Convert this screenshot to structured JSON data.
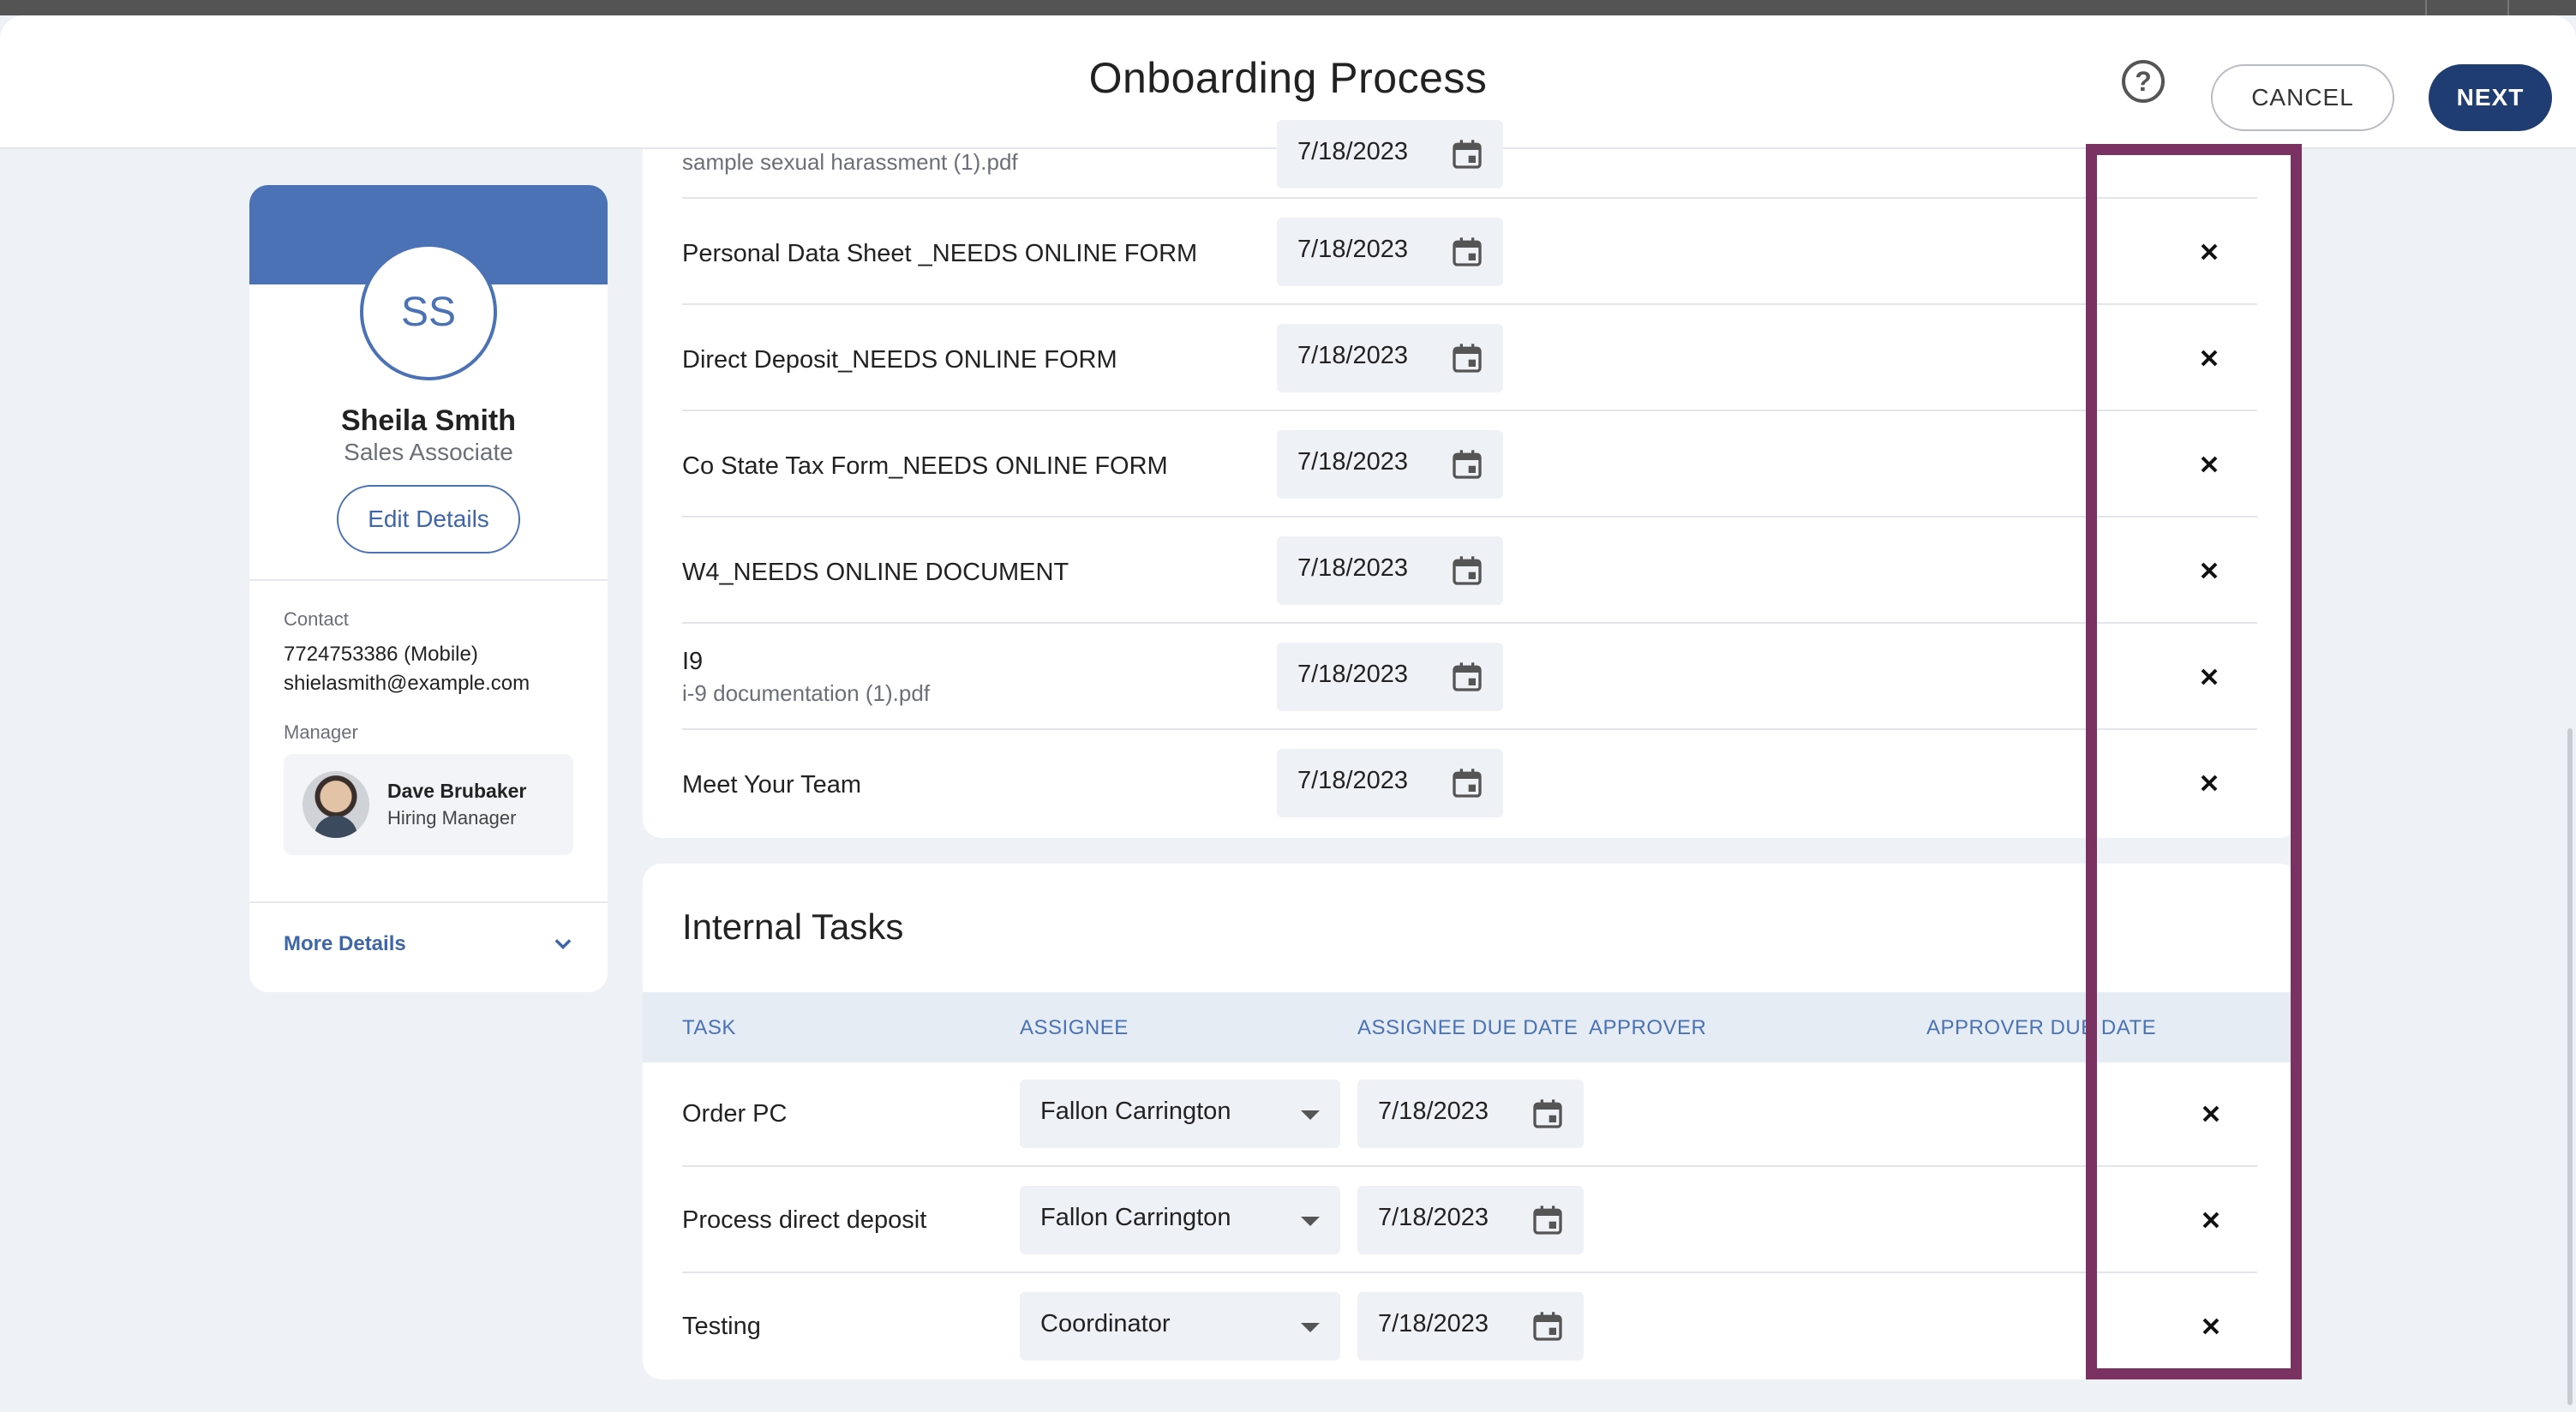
{
  "header": {
    "title": "Onboarding Process",
    "help_symbol": "?",
    "cancel_label": "CANCEL",
    "next_label": "NEXT"
  },
  "profile": {
    "initials": "SS",
    "name": "Sheila Smith",
    "role": "Sales Associate",
    "edit_label": "Edit Details",
    "contact_label": "Contact",
    "phone": "7724753386 (Mobile)",
    "email": "shielasmith@example.com",
    "manager_label": "Manager",
    "manager_name": "Dave Brubaker",
    "manager_role": "Hiring Manager",
    "more_details_label": "More Details"
  },
  "documents": {
    "partial_row": {
      "date": "7/18/2023",
      "subtitle": "sample sexual harassment (1).pdf"
    },
    "rows": [
      {
        "title": "Personal Data Sheet _NEEDS ONLINE FORM",
        "subtitle": "",
        "date": "7/18/2023"
      },
      {
        "title": "Direct Deposit_NEEDS ONLINE FORM",
        "subtitle": "",
        "date": "7/18/2023"
      },
      {
        "title": "Co State Tax Form_NEEDS ONLINE FORM",
        "subtitle": "",
        "date": "7/18/2023"
      },
      {
        "title": "W4_NEEDS ONLINE DOCUMENT",
        "subtitle": "",
        "date": "7/18/2023"
      },
      {
        "title": "I9",
        "subtitle": "i-9 documentation (1).pdf",
        "date": "7/18/2023"
      },
      {
        "title": "Meet Your Team",
        "subtitle": "",
        "date": "7/18/2023"
      }
    ]
  },
  "internal_tasks": {
    "title": "Internal Tasks",
    "columns": {
      "task": "TASK",
      "assignee": "ASSIGNEE",
      "assignee_due": "ASSIGNEE DUE DATE",
      "approver": "APPROVER",
      "approver_due": "APPROVER DUE DATE"
    },
    "rows": [
      {
        "task": "Order PC",
        "assignee": "Fallon Carrington",
        "date": "7/18/2023"
      },
      {
        "task": "Process direct deposit",
        "assignee": "Fallon Carrington",
        "date": "7/18/2023"
      },
      {
        "task": "Testing",
        "assignee": "Coordinator",
        "date": "7/18/2023"
      }
    ]
  },
  "colors": {
    "brand_blue": "#4a72b5",
    "next_button": "#1f3d73",
    "highlight": "#7a3263"
  },
  "icons": [
    "help-icon",
    "calendar-icon",
    "close-icon",
    "chevron-down-icon",
    "dropdown-caret-icon"
  ]
}
